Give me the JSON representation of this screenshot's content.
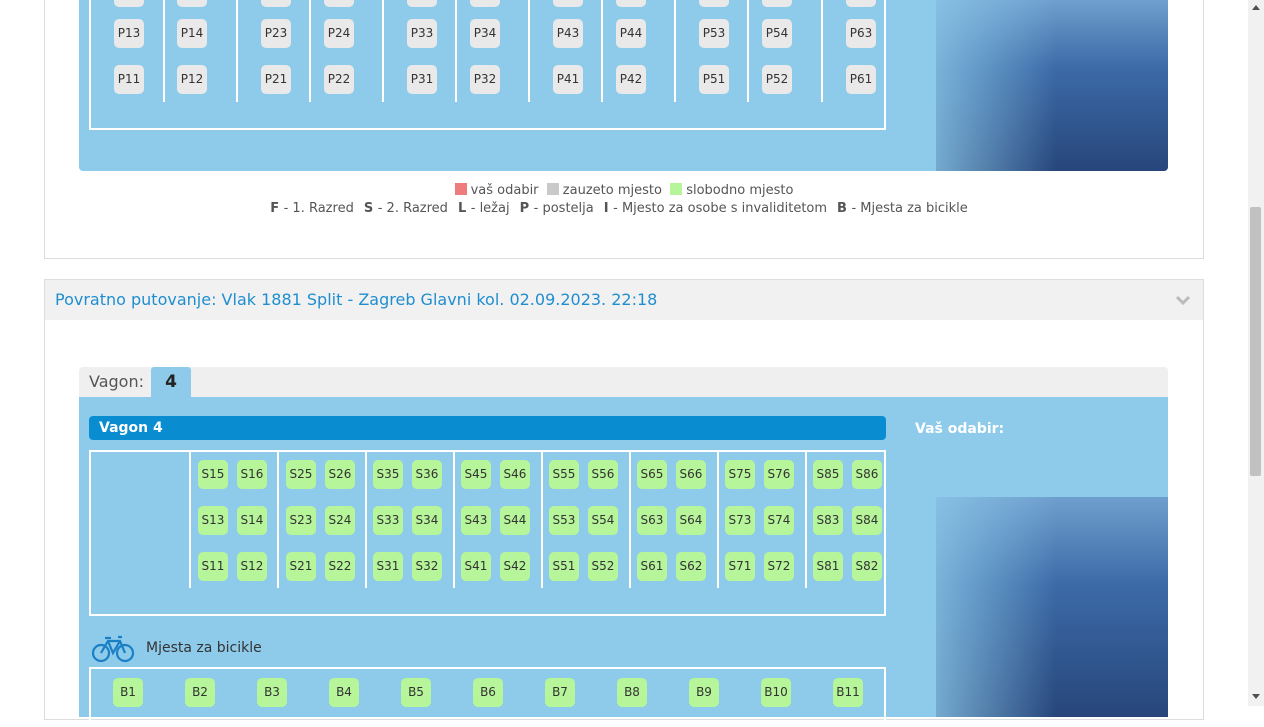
{
  "top_wagon": {
    "seats_row_upper": [
      "P13",
      "P14",
      "P23",
      "P24",
      "P33",
      "P34",
      "P43",
      "P44",
      "P53",
      "P54",
      "P63"
    ],
    "seats_row_lower": [
      "P11",
      "P12",
      "P21",
      "P22",
      "P31",
      "P32",
      "P41",
      "P42",
      "P51",
      "P52",
      "P61"
    ]
  },
  "legend": {
    "selected": "vaš odabir",
    "taken": "zauzeto mjesto",
    "free": "slobodno mjesto",
    "abbr": [
      {
        "key": "F",
        "text": "- 1. Razred"
      },
      {
        "key": "S",
        "text": "- 2. Razred"
      },
      {
        "key": "L",
        "text": "- ležaj"
      },
      {
        "key": "P",
        "text": "- postelja"
      },
      {
        "key": "I",
        "text": "- Mjesto za osobe s invaliditetom"
      },
      {
        "key": "B",
        "text": "- Mjesta za bicikle"
      }
    ],
    "colors": {
      "selected": "#ef7c7c",
      "taken": "#c9c9c9",
      "free": "#b7f59b"
    }
  },
  "return_section": {
    "title": "Povratno putovanje: Vlak 1881 Split - Zagreb Glavni kol. 02.09.2023. 22:18",
    "wagon_label": "Vagon:",
    "wagon_tab": "4",
    "wagon_header": "Vagon 4",
    "your_choice": "Vaš odabir:",
    "seat_rows": [
      [
        "S15",
        "S16",
        "S25",
        "S26",
        "S35",
        "S36",
        "S45",
        "S46",
        "S55",
        "S56",
        "S65",
        "S66",
        "S75",
        "S76",
        "S85",
        "S86"
      ],
      [
        "S13",
        "S14",
        "S23",
        "S24",
        "S33",
        "S34",
        "S43",
        "S44",
        "S53",
        "S54",
        "S63",
        "S64",
        "S73",
        "S74",
        "S83",
        "S84"
      ],
      [
        "S11",
        "S12",
        "S21",
        "S22",
        "S31",
        "S32",
        "S41",
        "S42",
        "S51",
        "S52",
        "S61",
        "S62",
        "S71",
        "S72",
        "S81",
        "S82"
      ]
    ],
    "bike_label": "Mjesta za bicikle",
    "bike_seats": [
      "B1",
      "B2",
      "B3",
      "B4",
      "B5",
      "B6",
      "B7",
      "B8",
      "B9",
      "B10",
      "B11"
    ]
  },
  "colors": {
    "accent": "#1f8ed0",
    "panel": "#8ecbea",
    "header_bar": "#0a8dd0"
  }
}
